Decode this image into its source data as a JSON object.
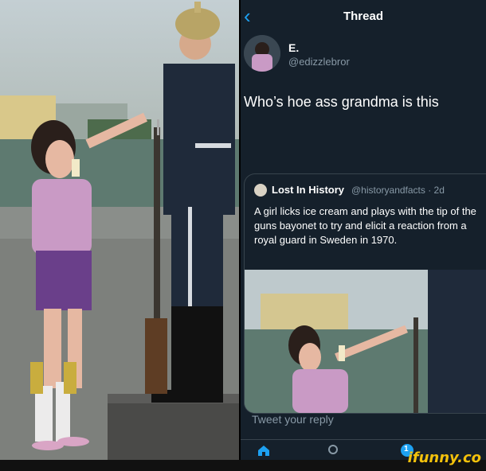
{
  "thread": {
    "title": "Thread",
    "tweet": {
      "name": "E.",
      "handle": "@edizzlebror",
      "text": "Who’s hoe ass grandma is this"
    },
    "quote": {
      "name": "Lost In History",
      "handle": "@historyandfacts · 2d",
      "text": "A girl licks ice cream and plays with the tip of the guns bayonet to try and elicit a reaction from a royal guard in Sweden in 1970."
    },
    "reply_placeholder": "Tweet your reply",
    "nav_badge": "1"
  },
  "watermark": "ifunny.co",
  "colors": {
    "background": "#15202b",
    "accent": "#1da1f2",
    "muted": "#8899a6",
    "border": "#38444d",
    "watermark": "#f3c10b"
  },
  "icons": [
    "chevron-left-icon",
    "home-icon",
    "search-icon",
    "notifications-icon"
  ]
}
